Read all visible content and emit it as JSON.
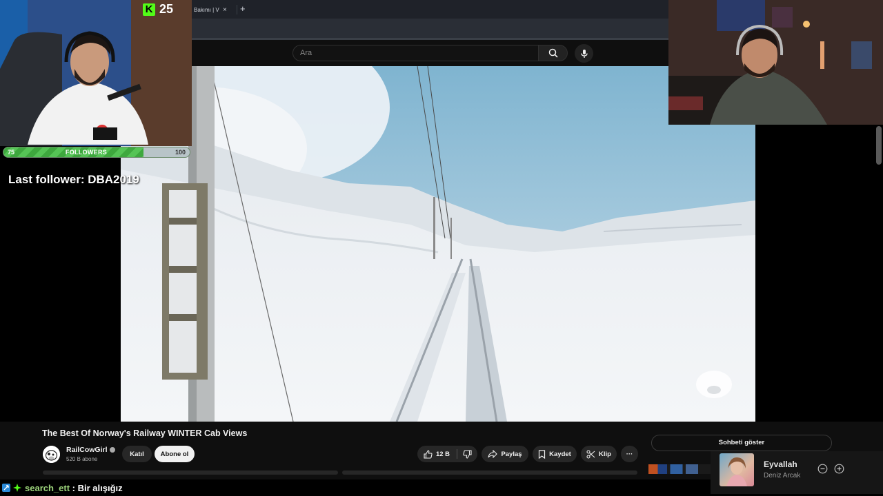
{
  "browser": {
    "tab_title": "Bakımı | V",
    "tab_close": "×",
    "new_tab": "+"
  },
  "youtube": {
    "search_placeholder": "Ara"
  },
  "overlay": {
    "kick_logo": "K",
    "kick_viewers": "25",
    "follower_goal": {
      "current": 75,
      "label": "FOLLOWERS",
      "target": 100,
      "min_label": "75",
      "max_label": "100"
    },
    "last_follower": "Last follower: DBA2019"
  },
  "video": {
    "title": "The Best Of Norway's Railway WINTER Cab Views",
    "channel": {
      "name": "RailCowGirl",
      "subscribers": "520 B abone"
    },
    "join_label": "Katıl",
    "subscribe_label": "Abone ol",
    "likes": "12 B",
    "share_label": "Paylaş",
    "save_label": "Kaydet",
    "clip_label": "Klip",
    "more_label": "···"
  },
  "chat": {
    "show_chat_label": "Sohbeti göster",
    "message": {
      "user": "search_ett",
      "separator": " : ",
      "text": "Bir alışığız"
    }
  },
  "music": {
    "title": "Eyvallah",
    "artist": "Deniz Arcak"
  },
  "colors": {
    "kick_green": "#53fc18",
    "follower_bar": "#3ea83e",
    "chat_username": "#9bd27a",
    "youtube_bg": "#0f0f0f"
  }
}
